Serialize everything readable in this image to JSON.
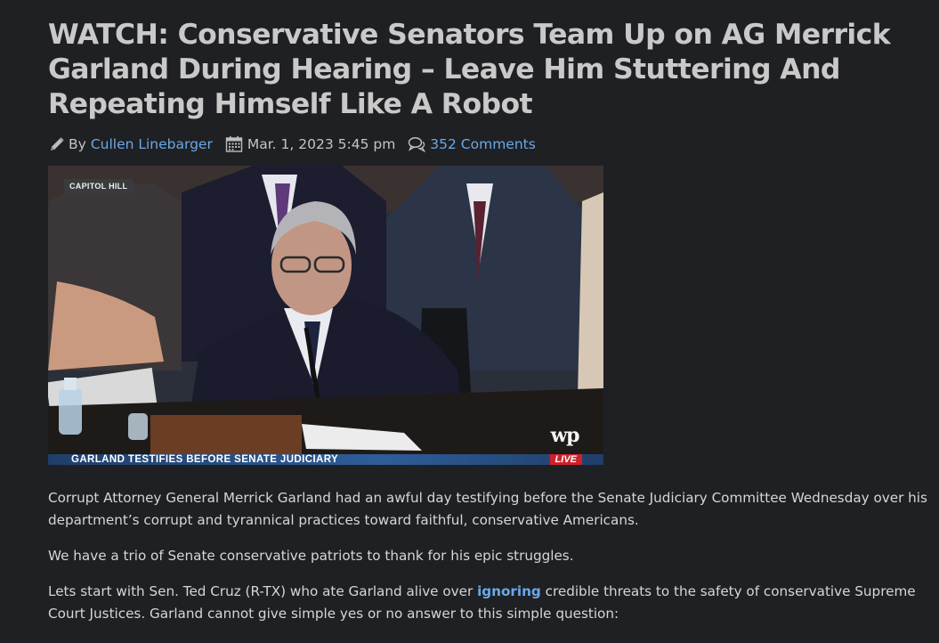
{
  "article": {
    "headline": "WATCH: Conservative Senators Team Up on AG Merrick Garland During Hearing – Leave Him Stuttering And Repeating Himself Like A Robot",
    "author_prefix": "By",
    "author": "Cullen Linebarger",
    "date": "Mar. 1, 2023 5:45 pm",
    "comments": "352 Comments",
    "icons": [
      "pencil-icon",
      "calendar-icon",
      "comments-icon"
    ]
  },
  "hero": {
    "location_tag": "CAPITOL HILL",
    "logo": "wp",
    "chyron": "GARLAND TESTIFIES BEFORE SENATE JUDICIARY",
    "live_label": "LIVE"
  },
  "body": {
    "p1": "Corrupt Attorney General Merrick Garland had an awful day testifying before the Senate Judiciary Committee Wednesday over his department’s corrupt and tyrannical practices toward faithful, conservative Americans.",
    "p2": "We have a trio of Senate conservative patriots to thank for his epic struggles.",
    "p3_before": "Lets start with Sen. Ted Cruz (R-TX) who ate Garland alive over ",
    "p3_link": "ignoring",
    "p3_after": " credible threats to the safety of conservative Supreme Court Justices. Garland cannot give simple yes or no answer to this simple question:"
  },
  "colors": {
    "background": "#1f2023",
    "headline": "#c9c9c9",
    "link": "#6aa9e8",
    "body_text": "#d6d6d6"
  }
}
